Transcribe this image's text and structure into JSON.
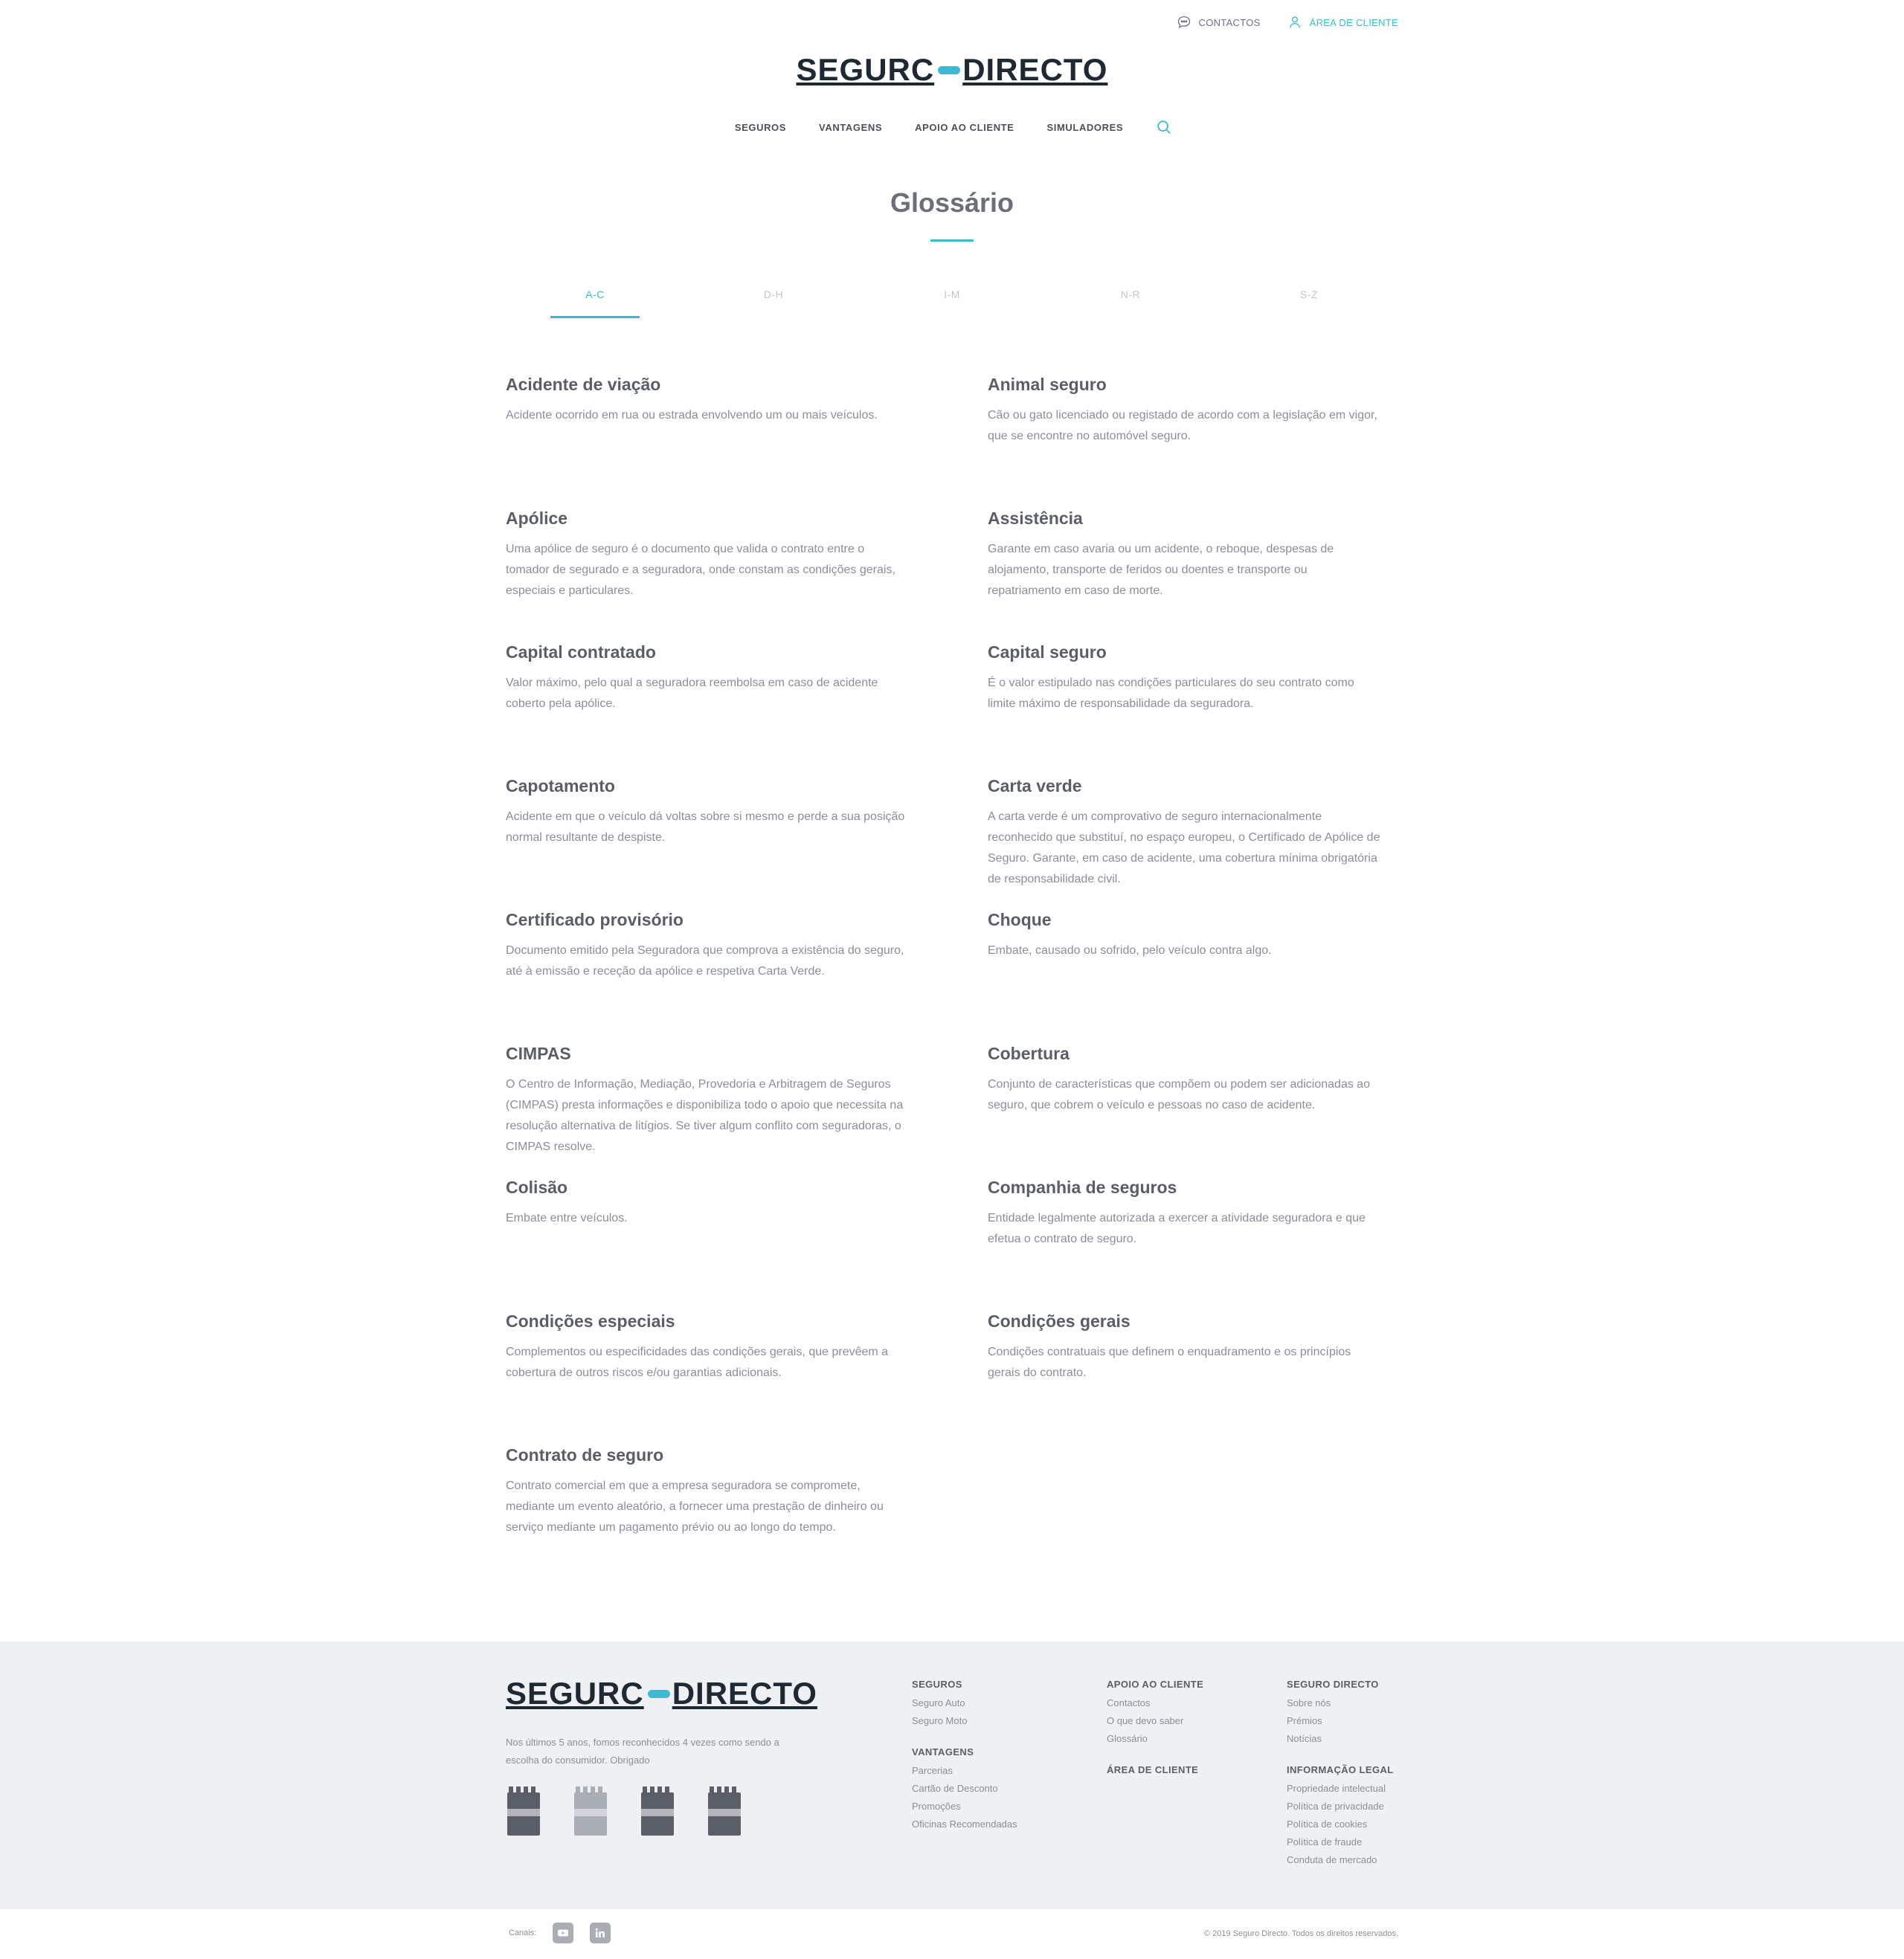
{
  "topbar": {
    "contacts": "CONTACTOS",
    "client_area": "ÁREA DE CLIENTE"
  },
  "logo": {
    "left": "SEGURC",
    "right": "DIRECTO"
  },
  "nav": {
    "items": [
      "SEGUROS",
      "VANTAGENS",
      "APOIO AO CLIENTE",
      "SIMULADORES"
    ]
  },
  "page": {
    "title": "Glossário"
  },
  "tabs": [
    "A-C",
    "D-H",
    "I-M",
    "N-R",
    "S-Z"
  ],
  "glossary": [
    {
      "term": "Acidente de viação",
      "definition": "Acidente ocorrido em rua ou estrada envolvendo um ou mais veículos."
    },
    {
      "term": "Animal seguro",
      "definition": "Cão ou gato licenciado ou registado de acordo com a legislação em vigor, que se encontre no automóvel seguro."
    },
    {
      "term": "Apólice",
      "definition": "Uma apólice de seguro é o documento que valida o contrato entre o tomador de segurado e a seguradora, onde constam as condições gerais, especiais e particulares."
    },
    {
      "term": "Assistência",
      "definition": "Garante em caso avaria ou um acidente, o reboque, despesas de alojamento, transporte de feridos ou doentes e transporte ou repatriamento em caso de morte."
    },
    {
      "term": "Capital contratado",
      "definition": "Valor máximo, pelo qual a seguradora reembolsa em caso de acidente coberto pela apólice."
    },
    {
      "term": "Capital seguro",
      "definition": "É o valor estipulado nas condições particulares do seu contrato como limite máximo de responsabilidade da seguradora."
    },
    {
      "term": "Capotamento",
      "definition": "Acidente em que o veículo dá voltas sobre si mesmo e perde a sua posição normal resultante de despiste."
    },
    {
      "term": "Carta verde",
      "definition": "A carta verde é um comprovativo de seguro internacionalmente reconhecido que substituí, no espaço europeu, o Certificado de Apólice de Seguro. Garante, em caso de acidente, uma cobertura mínima obrigatória de responsabilidade civil."
    },
    {
      "term": "Certificado provisório",
      "definition": "Documento emitido pela Seguradora que comprova a existência do seguro, até à emissão e receção da apólice e respetiva Carta Verde."
    },
    {
      "term": "Choque",
      "definition": "Embate, causado ou sofrido, pelo veículo contra algo."
    },
    {
      "term": "CIMPAS",
      "definition": "O Centro de Informação, Mediação, Provedoria e Arbitragem de Seguros (CIMPAS) presta informações e disponibiliza todo o apoio que necessita na resolução alternativa de litígios. Se tiver algum conflito com seguradoras, o CIMPAS resolve."
    },
    {
      "term": "Cobertura",
      "definition": "Conjunto de características que compõem ou podem ser adicionadas ao seguro, que cobrem o veículo e pessoas no caso de acidente."
    },
    {
      "term": "Colisão",
      "definition": "Embate entre veículos."
    },
    {
      "term": "Companhia de seguros",
      "definition": "Entidade legalmente autorizada a exercer a atividade seguradora e que efetua o contrato de seguro."
    },
    {
      "term": "Condições especiais",
      "definition": "Complementos ou especificidades das condições gerais, que prevêem a cobertura de outros riscos e/ou garantias adicionais."
    },
    {
      "term": "Condições gerais",
      "definition": "Condições contratuais que definem o enquadramento e os princípios gerais do contrato."
    },
    {
      "term": "Contrato de seguro",
      "definition": "Contrato comercial em que a empresa seguradora se compromete, mediante um evento aleatório, a fornecer uma prestação de dinheiro ou serviço mediante um pagamento prévio ou ao longo do tempo."
    }
  ],
  "footer": {
    "tagline": "Nos últimos 5 anos, fomos reconhecidos 4 vezes como sendo a escolha do consumidor. Obrigado",
    "col1": {
      "g1_title": "SEGUROS",
      "g1_links": [
        "Seguro Auto",
        "Seguro Moto"
      ],
      "g2_title": "VANTAGENS",
      "g2_links": [
        "Parcerias",
        "Cartão de Desconto",
        "Promoções",
        "Oficinas Recomendadas"
      ]
    },
    "col2": {
      "g1_title": "APOIO AO CLIENTE",
      "g1_links": [
        "Contactos",
        "O que devo saber",
        "Glossário"
      ],
      "g2_title": "ÁREA DE CLIENTE"
    },
    "col3": {
      "g1_title": "SEGURO DIRECTO",
      "g1_links": [
        "Sobre nós",
        "Prémios",
        "Notícias"
      ],
      "g2_title": "INFORMAÇÃO LEGAL",
      "g2_links": [
        "Propriedade intelectual",
        "Política de privacidade",
        "Política de cookies",
        "Política de fraude",
        "Conduta de mercado"
      ]
    },
    "channels_label": "Canais:",
    "copyright": "© 2019 Seguro Directo. Todos os direitos reservados."
  },
  "colors": {
    "accent": "#3bbbd3",
    "text_dark": "#4a4f59",
    "text_muted": "#8a8e96",
    "footer_bg": "#eef0f4"
  },
  "icons": {
    "contacts": "chat-bubble-icon",
    "client": "user-icon",
    "search": "search-icon",
    "youtube": "youtube-icon",
    "linkedin": "linkedin-icon"
  }
}
